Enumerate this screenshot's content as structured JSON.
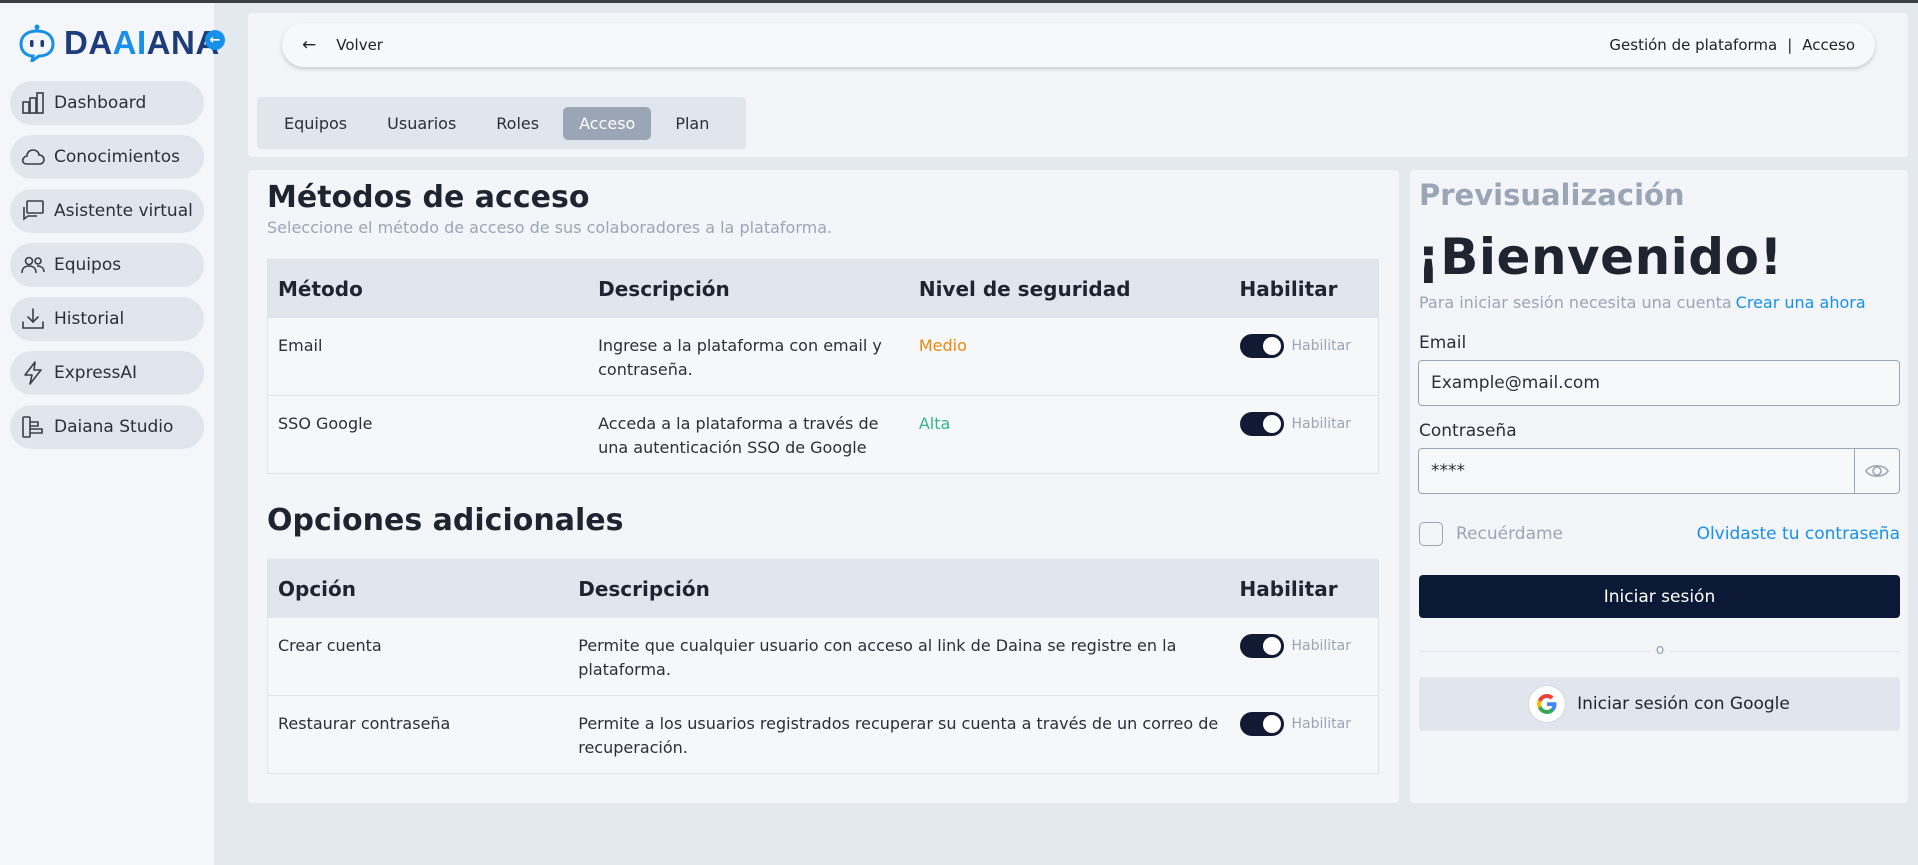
{
  "brand": {
    "logo_text_1": "DA",
    "logo_text_ai": "AI",
    "logo_text_2": "ANA",
    "accent": "#1690e8",
    "dark": "#0b1836"
  },
  "sidebar": {
    "items": [
      {
        "label": "Dashboard",
        "icon": "bar-chart-icon"
      },
      {
        "label": "Conocimientos",
        "icon": "cloud-icon"
      },
      {
        "label": "Asistente virtual",
        "icon": "chat-icon"
      },
      {
        "label": "Equipos",
        "icon": "users-icon"
      },
      {
        "label": "Historial",
        "icon": "download-icon"
      },
      {
        "label": "ExpressAI",
        "icon": "lightning-icon"
      },
      {
        "label": "Daiana Studio",
        "icon": "studio-icon"
      }
    ]
  },
  "topbar": {
    "back_label": "Volver",
    "crumb_1": "Gestión de plataforma",
    "crumb_sep": "|",
    "crumb_2": "Acceso"
  },
  "tabs": [
    "Equipos",
    "Usuarios",
    "Roles",
    "Acceso",
    "Plan"
  ],
  "active_tab": "Acceso",
  "access": {
    "title": "Métodos de acceso",
    "subtitle": "Seleccione el método de acceso de sus colaboradores a la plataforma.",
    "headers": [
      "Método",
      "Descripción",
      "Nivel de seguridad",
      "Habilitar"
    ],
    "rows": [
      {
        "method": "Email",
        "description": "Ingrese a la plataforma con email y contraseña.",
        "level": "Medio",
        "enabled": true,
        "toggle_label": "Habilitar"
      },
      {
        "method": "SSO Google",
        "description": "Acceda a la plataforma a través de una autenticación SSO de Google",
        "level": "Alta",
        "enabled": true,
        "toggle_label": "Habilitar"
      }
    ]
  },
  "options": {
    "title": "Opciones adicionales",
    "headers": [
      "Opción",
      "Descripción",
      "Habilitar"
    ],
    "rows": [
      {
        "option": "Crear cuenta",
        "description": "Permite que cualquier usuario con acceso al link de Daina se registre en la plataforma.",
        "enabled": true,
        "toggle_label": "Habilitar"
      },
      {
        "option": "Restaurar contraseña",
        "description": "Permite a los usuarios registrados recuperar su cuenta a través de un correo de recuperación.",
        "enabled": true,
        "toggle_label": "Habilitar"
      }
    ]
  },
  "preview": {
    "title": "Previsualización",
    "welcome": "¡Bienvenido!",
    "signup_prompt": "Para iniciar sesión necesita una cuenta",
    "signup_link": "Crear una ahora",
    "email_label": "Email",
    "email_value": "Example@mail.com",
    "password_label": "Contraseña",
    "password_value": "****",
    "remember_label": "Recuérdame",
    "forgot_label": "Olvidaste tu contraseña",
    "login_button": "Iniciar sesión",
    "divider_text": "o",
    "google_button": "Iniciar sesión con Google"
  }
}
